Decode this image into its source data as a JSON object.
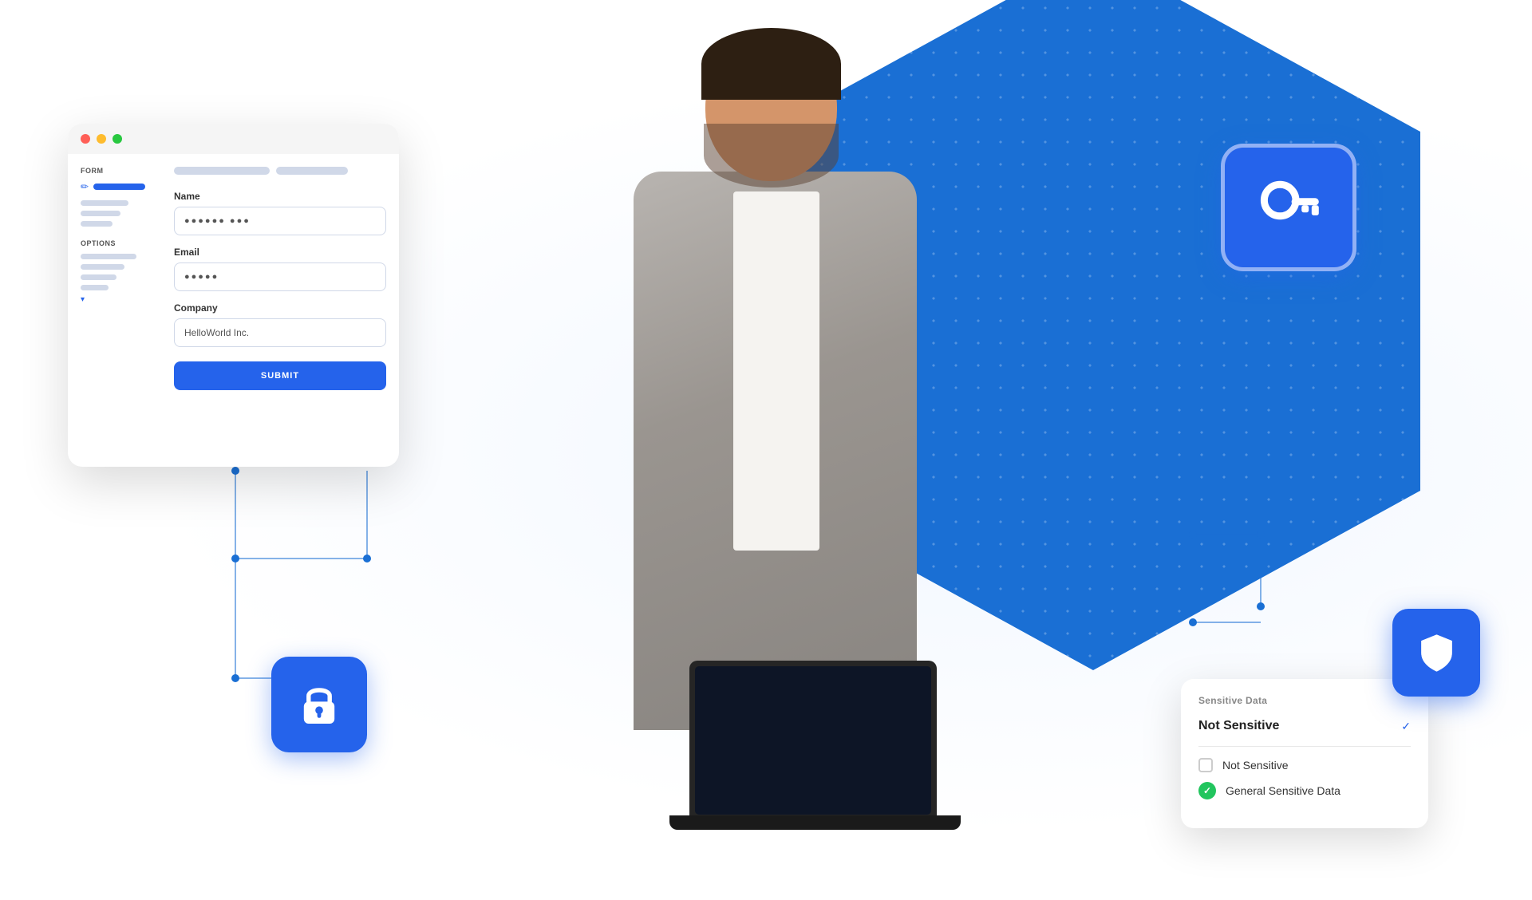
{
  "scene": {
    "bg_color": "#ffffff"
  },
  "form_card": {
    "title": "FORM",
    "options_label": "OPTIONS",
    "fields": {
      "name_label": "Name",
      "name_dots": "●●●●●● ●●●",
      "email_label": "Email",
      "email_dots": "●●●●●",
      "company_label": "Company",
      "company_value": "HelloWorld Inc.",
      "submit_label": "SUBMIT"
    }
  },
  "key_card": {
    "icon": "key-icon"
  },
  "lock_card": {
    "icon": "lock-icon"
  },
  "shield_card": {
    "icon": "shield-icon"
  },
  "sensitive_card": {
    "title": "Sensitive Data",
    "selected_label": "Not Sensitive",
    "options": [
      {
        "label": "Not Sensitive",
        "checked": false
      },
      {
        "label": "General Sensitive Data",
        "checked": true
      }
    ]
  }
}
